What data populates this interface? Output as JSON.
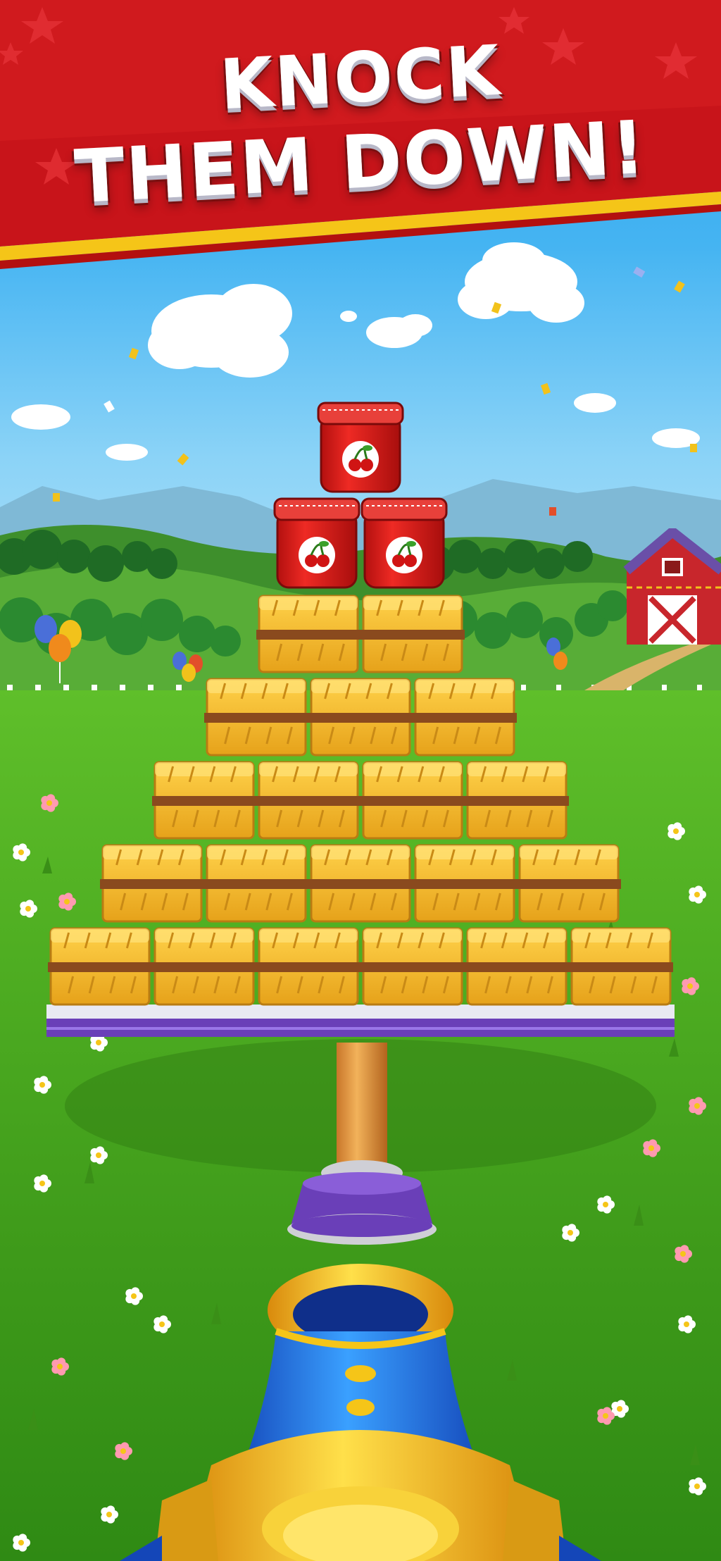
{
  "banner": {
    "title_line_1": "KNOCK",
    "title_line_2": "THEM DOWN!",
    "background_color": "#c8141a",
    "stripe_color": "#f5c518"
  },
  "scene": {
    "sky_color": "#45b4f2",
    "grass_color": "#4fae22",
    "barn_color": "#c8262c",
    "jar_color": "#e0201e",
    "jar_icon": "cherry-icon",
    "hay_color": "#f0b429",
    "platform_color": "#6a3fb8",
    "cannon_body_color": "#1f6fe0",
    "cannon_trim_color": "#f5c518"
  },
  "tower": {
    "hay_rows": [
      6,
      5,
      4,
      3,
      2
    ],
    "jar_rows": [
      2,
      1
    ]
  }
}
